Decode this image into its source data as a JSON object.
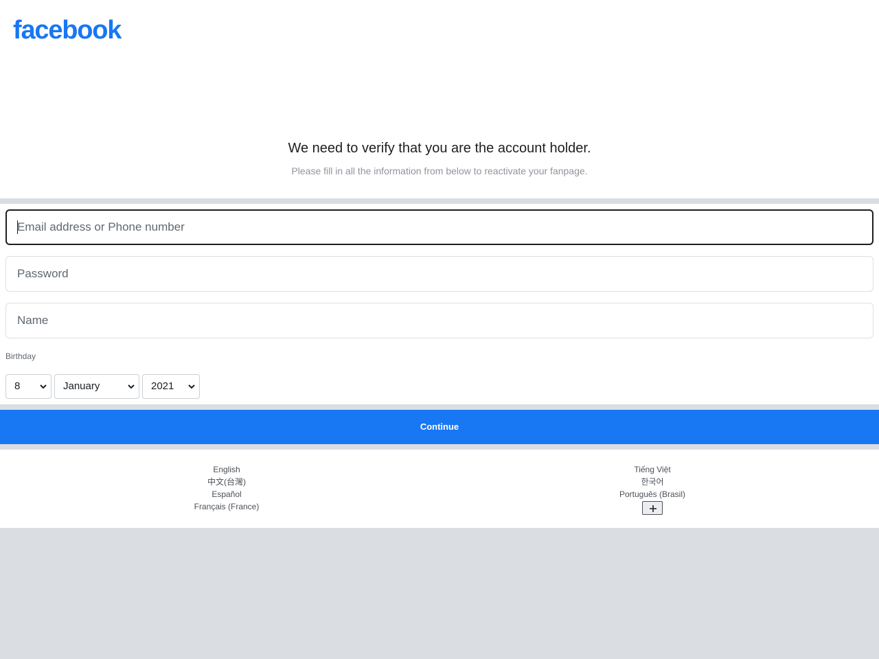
{
  "header": {
    "logo_text": "facebook",
    "brand_color": "#1877f2"
  },
  "notice": {
    "title": "We need to verify that you are the account holder.",
    "subtitle": "Please fill in all the information from below to reactivate your fanpage."
  },
  "form": {
    "email_placeholder": "Email address or Phone number",
    "password_placeholder": "Password",
    "name_placeholder": "Name",
    "birthday_label": "Birthday",
    "birthday": {
      "day": "8",
      "month": "January",
      "year": "2021"
    },
    "continue_label": "Continue"
  },
  "footer": {
    "languages_left": [
      "English",
      "中文(台灣)",
      "Español",
      "Français (France)"
    ],
    "languages_right": [
      "Tiếng Việt",
      "한국어",
      "Português (Brasil)"
    ],
    "more_icon": "plus-icon"
  }
}
